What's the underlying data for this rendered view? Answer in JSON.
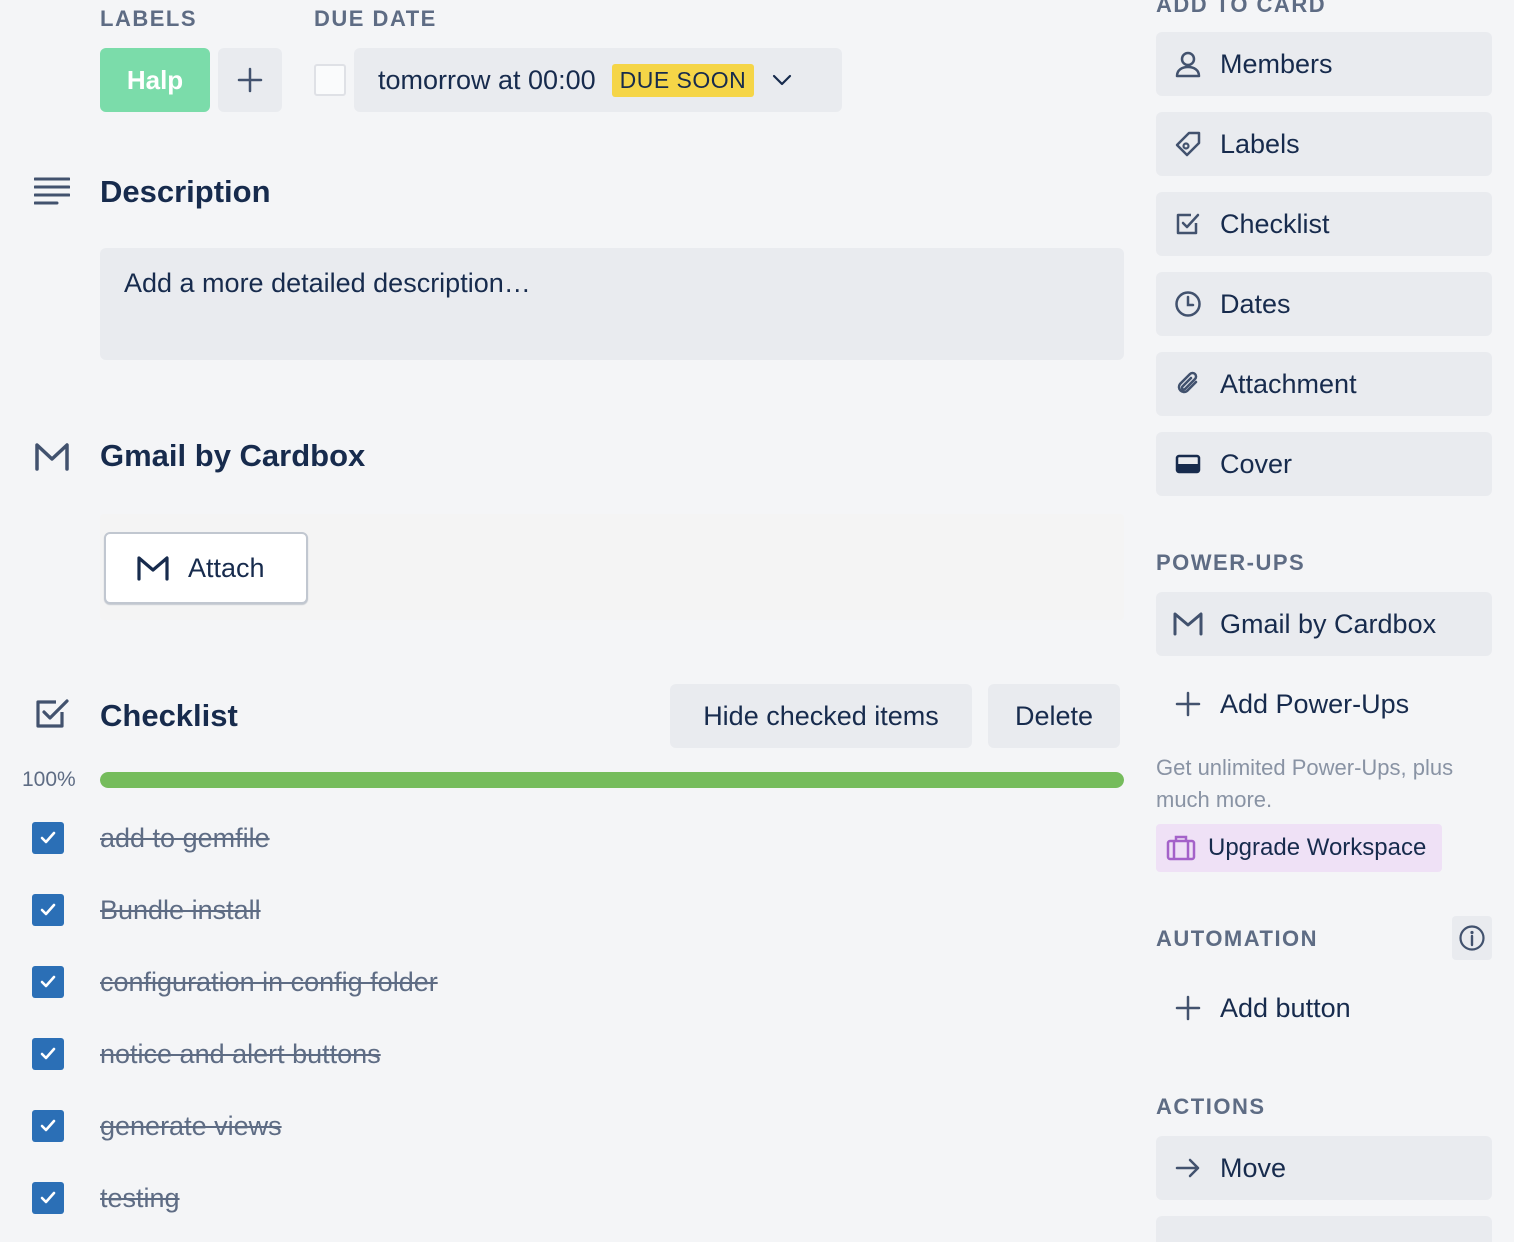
{
  "header": {
    "labels_caption": "LABELS",
    "due_caption": "DUE DATE",
    "label_chip": "Halp",
    "due_text": "tomorrow at 00:00",
    "due_badge": "DUE SOON"
  },
  "description": {
    "title": "Description",
    "placeholder": "Add a more detailed description…"
  },
  "gmail": {
    "title": "Gmail by Cardbox",
    "attach_label": "Attach"
  },
  "checklist": {
    "title": "Checklist",
    "hide_label": "Hide checked items",
    "delete_label": "Delete",
    "percent_text": "100%",
    "progress": 1.0,
    "items": [
      {
        "text": "add to gemfile",
        "checked": true
      },
      {
        "text": "Bundle install",
        "checked": true
      },
      {
        "text": "configuration in config folder",
        "checked": true
      },
      {
        "text": "notice and alert buttons",
        "checked": true
      },
      {
        "text": "generate views",
        "checked": true
      },
      {
        "text": "testing",
        "checked": true
      }
    ]
  },
  "sidebar": {
    "add_to_card_caption": "ADD TO CARD",
    "add_to_card": [
      {
        "label": "Members",
        "icon": "person-icon"
      },
      {
        "label": "Labels",
        "icon": "tag-icon"
      },
      {
        "label": "Checklist",
        "icon": "checkbox-icon"
      },
      {
        "label": "Dates",
        "icon": "clock-icon"
      },
      {
        "label": "Attachment",
        "icon": "paperclip-icon"
      },
      {
        "label": "Cover",
        "icon": "cover-icon"
      }
    ],
    "powerups_caption": "POWER-UPS",
    "powerup_gmail": "Gmail by Cardbox",
    "add_powerups": "Add Power-Ups",
    "promo_text": "Get unlimited Power-Ups, plus much more.",
    "upgrade_label": "Upgrade Workspace",
    "automation_caption": "AUTOMATION",
    "add_button": "Add button",
    "actions_caption": "ACTIONS",
    "move_label": "Move"
  },
  "colors": {
    "label_green": "#7bdcaa",
    "due_soon_yellow": "#f5d547",
    "progress_green": "#75bc5c",
    "check_blue": "#2b6fb6",
    "upgrade_purple": "#efe1f6"
  }
}
